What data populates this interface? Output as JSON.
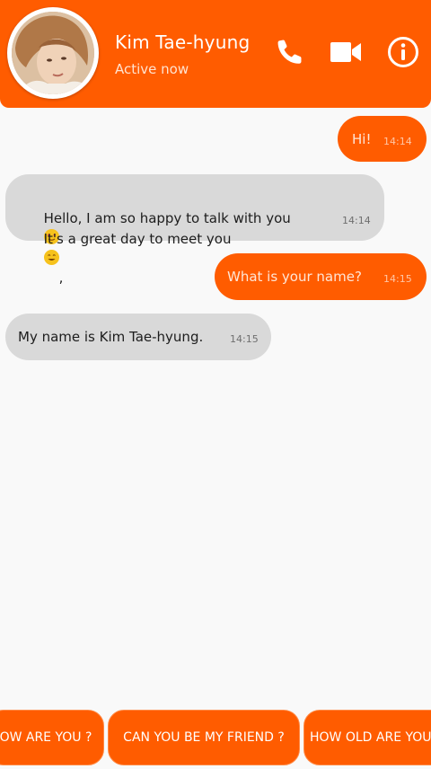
{
  "contact": {
    "name": "Kim Tae-hyung",
    "status": "Active now"
  },
  "header_icons": [
    "phone-icon",
    "video-camera-icon",
    "info-icon"
  ],
  "messages": [
    {
      "direction": "outgoing",
      "text": "Hi!",
      "time": "14:14"
    },
    {
      "direction": "incoming",
      "line1": "Hello, I am so happy to talk with you",
      "line1_tail": ",",
      "line2": "It's a great day to meet you",
      "time": "14:14"
    },
    {
      "direction": "outgoing",
      "text": "What is your name?",
      "time": "14:15"
    },
    {
      "direction": "incoming",
      "text": "My name is Kim Tae-hyung.",
      "time": "14:15"
    }
  ],
  "quick_replies": [
    "OW ARE YOU ?",
    "CAN YOU BE MY FRIEND ?",
    "HOW OLD ARE YOU"
  ],
  "colors": {
    "accent": "#ff5c00",
    "incoming_bubble": "#d9d9d9",
    "background": "#f9f9f9"
  }
}
